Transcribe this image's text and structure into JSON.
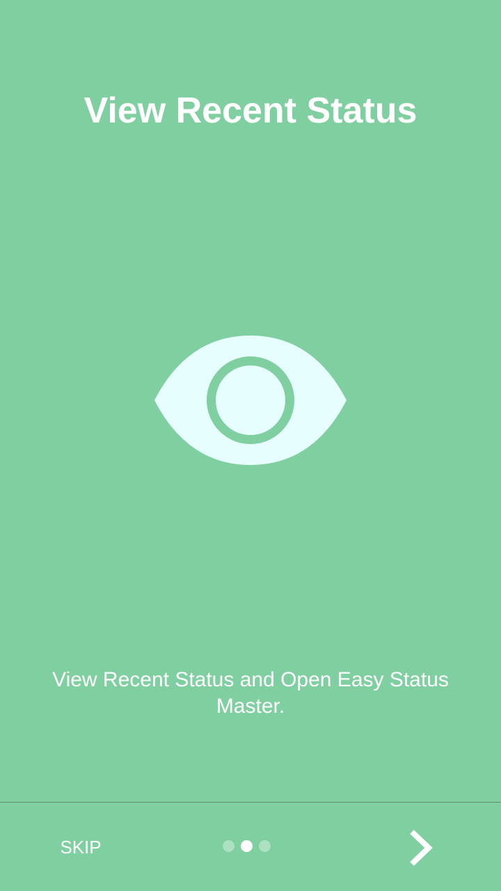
{
  "onboarding": {
    "title": "View Recent Status",
    "description": "View Recent Status and Open Easy Status Master.",
    "hero_icon": "eye-icon",
    "skip_label": "SKIP",
    "next_icon": "chevron-right-icon",
    "page_indicator": {
      "total": 3,
      "current": 2
    }
  },
  "colors": {
    "background": "#7fcfa0",
    "icon_fill": "#e6fefe",
    "text": "#ffffff",
    "divider": "#5e8f73"
  }
}
